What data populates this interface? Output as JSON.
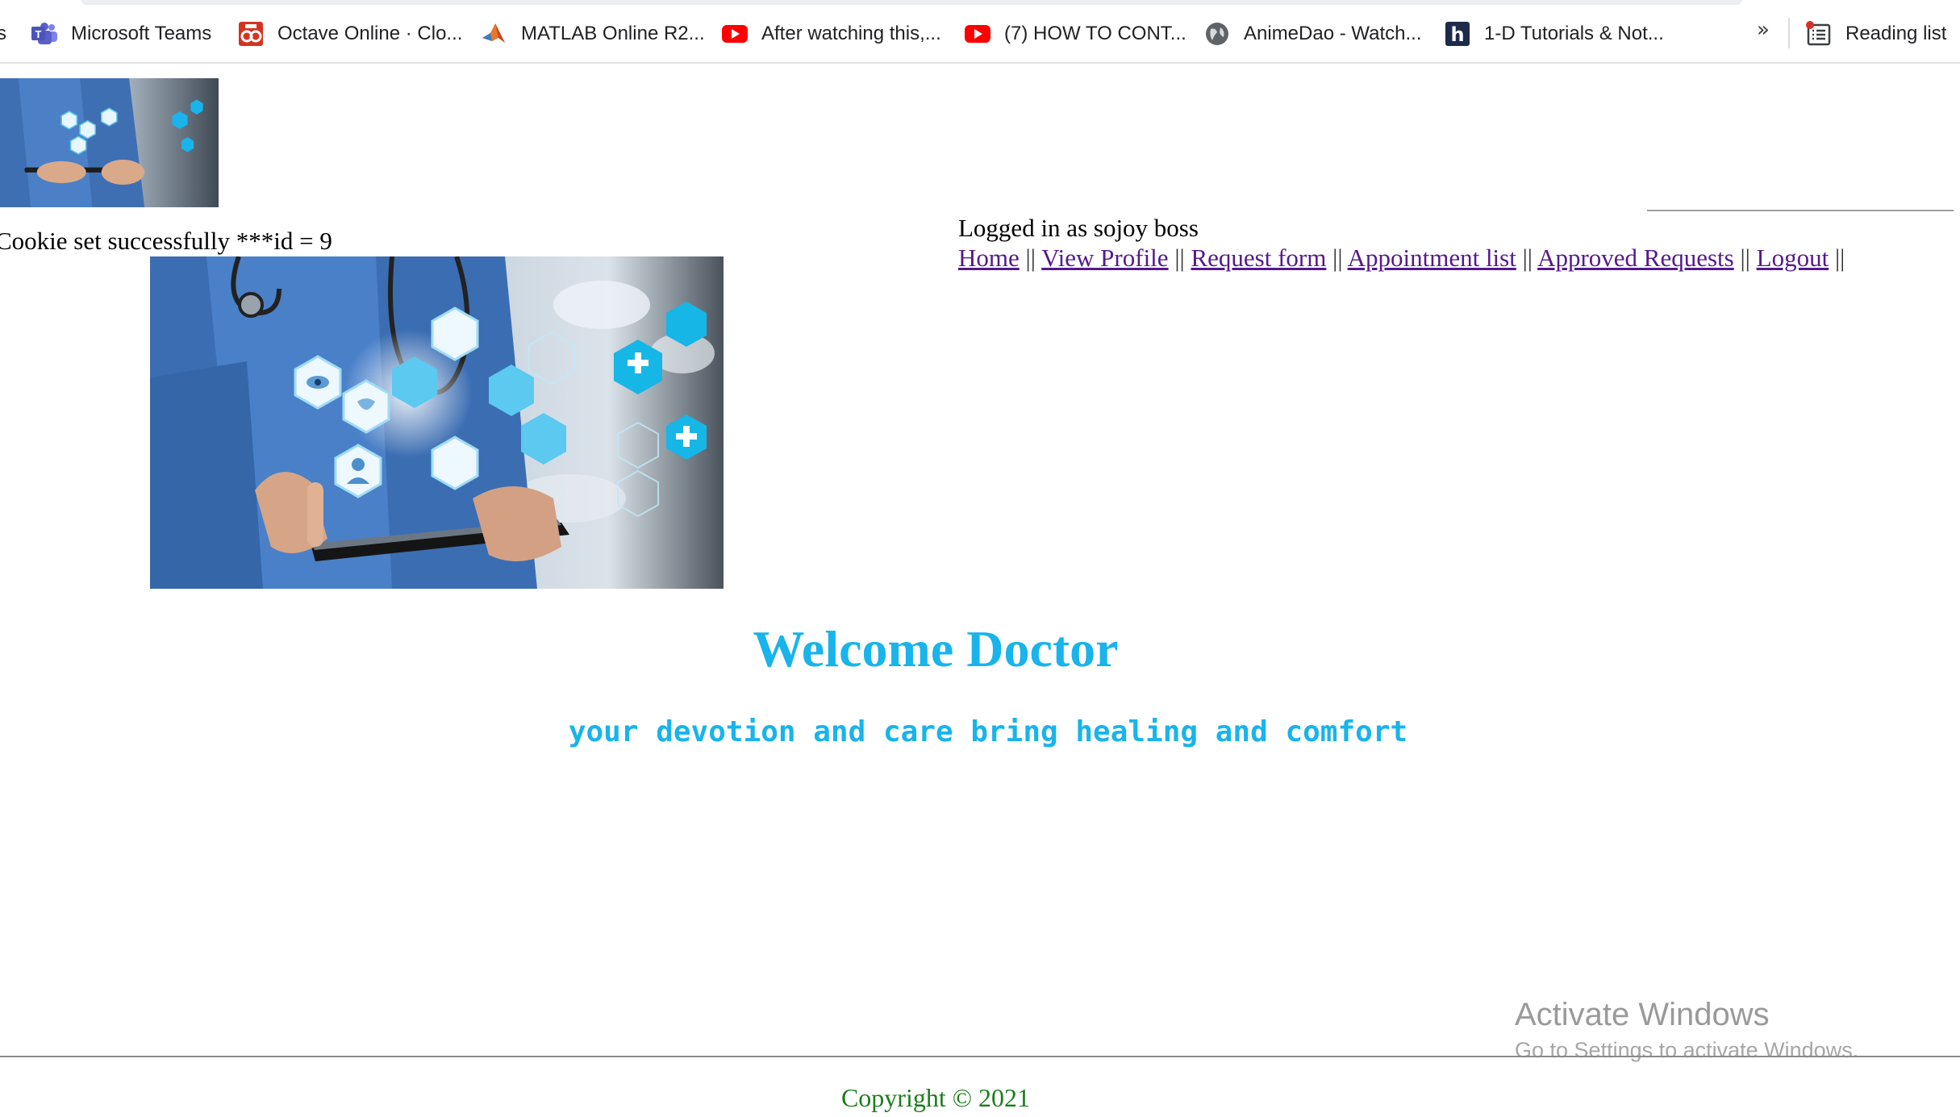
{
  "bookmarks_bar": {
    "cut_label": "s",
    "items": [
      {
        "label": "Microsoft Teams",
        "icon": "teams-icon",
        "color": "#5b5fc7"
      },
      {
        "label": "Octave Online · Clo...",
        "icon": "octave-icon",
        "color": "#d4341f"
      },
      {
        "label": "MATLAB Online R2...",
        "icon": "matlab-icon",
        "color": "#e8772e"
      },
      {
        "label": "After watching this,...",
        "icon": "youtube-icon",
        "color": "#ff0000"
      },
      {
        "label": "(7) HOW TO CONT...",
        "icon": "youtube-icon",
        "color": "#ff0000"
      },
      {
        "label": "AnimeDao - Watch...",
        "icon": "globe-icon",
        "color": "#5f6368"
      },
      {
        "label": "1-D Tutorials & Not...",
        "icon": "h-icon",
        "color": "#1e2a4a"
      }
    ],
    "more_label": "»",
    "reading_list_label": "Reading list"
  },
  "page": {
    "cookie_message": "Cookie set successfully ***id = 9",
    "logged_in_text": "Logged in as sojoy boss",
    "nav": [
      {
        "label": "Home"
      },
      {
        "label": "View Profile"
      },
      {
        "label": "Request form"
      },
      {
        "label": "Appointment list"
      },
      {
        "label": "Approved Requests"
      },
      {
        "label": "Logout"
      }
    ],
    "nav_separator": "||",
    "welcome_title": "Welcome Doctor",
    "tagline": "your devotion and care bring healing and comfort",
    "copyright": "Copyright © 2021"
  },
  "os_watermark": {
    "title": "Activate Windows",
    "subtitle": "Go to Settings to activate Windows."
  },
  "colors": {
    "accent": "#18b4eb",
    "link_visited": "#551a8b",
    "footer_text": "#1c7d1c"
  }
}
